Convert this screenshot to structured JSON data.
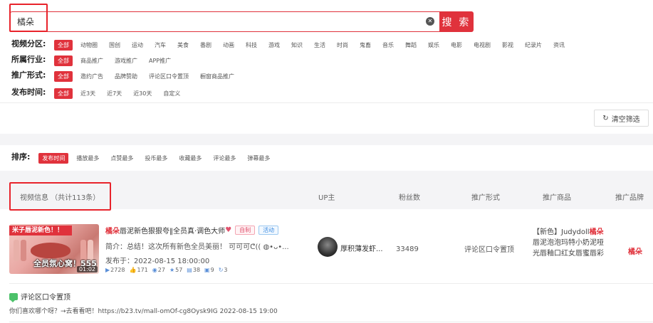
{
  "search": {
    "value": "橘朵",
    "clear_glyph": "✕",
    "button_label": "搜 索"
  },
  "filters": {
    "video_zone": {
      "label": "视频分区:",
      "options": [
        "全部",
        "动物圈",
        "国创",
        "运动",
        "汽车",
        "美食",
        "番剧",
        "动画",
        "科技",
        "游戏",
        "知识",
        "生活",
        "时尚",
        "鬼畜",
        "音乐",
        "舞蹈",
        "娱乐",
        "电影",
        "电视剧",
        "影视",
        "纪录片",
        "资讯"
      ]
    },
    "industry": {
      "label": "所属行业:",
      "options": [
        "全部",
        "商品推广",
        "游戏推广",
        "APP推广"
      ]
    },
    "promo_form": {
      "label": "推广形式:",
      "options": [
        "全部",
        "邀约广告",
        "品牌赞助",
        "评论区口令置顶",
        "橱窗商品推广"
      ]
    },
    "publish_time": {
      "label": "发布时间:",
      "options": [
        "全部",
        "近3天",
        "近7天",
        "近30天",
        "自定义"
      ]
    }
  },
  "clear_filters_label": "清空筛选",
  "sort": {
    "label": "排序:",
    "options": [
      "发布时间",
      "播放最多",
      "点赞最多",
      "投币最多",
      "收藏最多",
      "评论最多",
      "弹幕最多"
    ]
  },
  "table": {
    "headers": {
      "video_info": "视频信息 （共计113条）",
      "up": "UP主",
      "fans": "粉丝数",
      "promo_form": "推广形式",
      "goods": "推广商品",
      "brand": "推广品牌"
    },
    "rows": [
      {
        "thumb_top": "米子唇泥新色！！",
        "thumb_bottom": "全员氛心窝！555",
        "duration": "01:02",
        "title_hl": "橘朵",
        "title_rest": "唇泥新色狠狠夸‖全员真·调色大师",
        "heart": "♥",
        "tag_self": "自制",
        "tag_activity": "活动",
        "desc": "简介：总结！这次所有新色全员美丽！ 可可可ᕦ(( ◍•ᴗ•...",
        "publish": "发布于：2022-08-15 18:00:00",
        "stats": {
          "play": "2728",
          "like": "171",
          "coin": "27",
          "fav": "57",
          "danmaku": "38",
          "comment": "9",
          "share": "3"
        },
        "up_name": "厚积薄发虾...",
        "fans": "33489",
        "promo_form": "评论区口令置顶",
        "goods_prefix": "【新色】Judydoll",
        "goods_hl": "橘朵",
        "goods_rest": "唇泥泡泡玛特小奶泥哑光唇釉口红女唇蜜唇彩",
        "brand": "橘朵",
        "comment_title": "评论区口令置顶",
        "comment_body": "你们喜欢哪个呀？→去看看吧！https://b23.tv/mall-omOf-cg8Oysk9IG 2022-08-15 19:00"
      }
    ]
  },
  "colors": {
    "accent": "#e0323c",
    "highlight_box": "#e8232b"
  }
}
